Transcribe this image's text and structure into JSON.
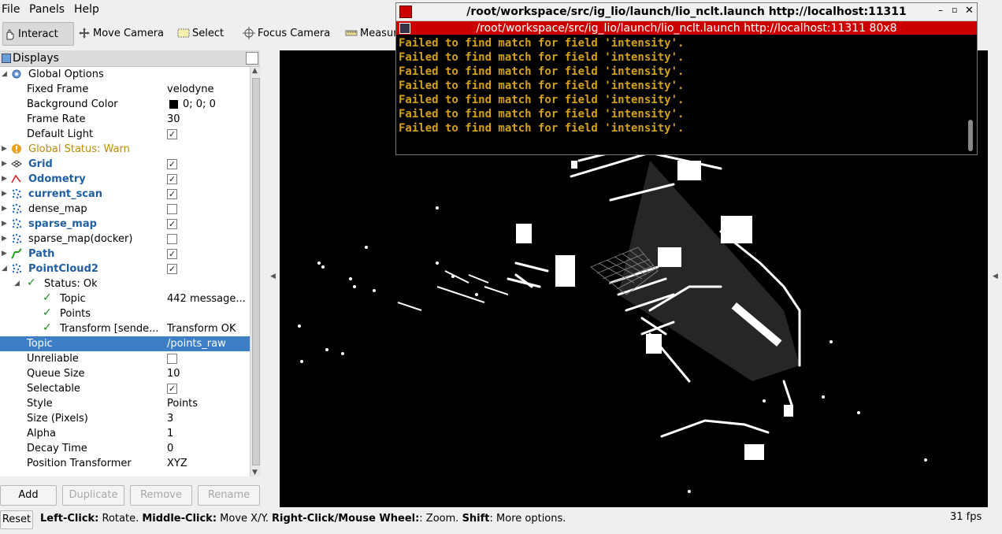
{
  "menu": [
    "File",
    "Panels",
    "Help"
  ],
  "tools": [
    {
      "label": "Interact",
      "icon": "interact-icon",
      "active": true
    },
    {
      "label": "Move Camera",
      "icon": "move-camera-icon"
    },
    {
      "label": "Select",
      "icon": "select-icon"
    },
    {
      "label": "Focus Camera",
      "icon": "focus-camera-icon"
    },
    {
      "label": "Measure",
      "icon": "measure-icon"
    }
  ],
  "displays_title": "Displays",
  "tree": [
    {
      "label": "Global Options",
      "icon": "gear-icon",
      "val": ""
    },
    {
      "label": "Fixed Frame",
      "val": "velodyne"
    },
    {
      "label": "Background Color",
      "val": "0; 0; 0"
    },
    {
      "label": "Frame Rate",
      "val": "30"
    },
    {
      "label": "Default Light",
      "val": "✓"
    },
    {
      "label": "Global Status: Warn"
    },
    {
      "label": "Grid",
      "val": "✓"
    },
    {
      "label": "Odometry",
      "val": "✓"
    },
    {
      "label": "current_scan",
      "val": "✓"
    },
    {
      "label": "dense_map",
      "val": ""
    },
    {
      "label": "sparse_map",
      "val": "✓"
    },
    {
      "label": "sparse_map(docker)",
      "val": ""
    },
    {
      "label": "Path",
      "val": "✓"
    },
    {
      "label": "PointCloud2",
      "val": "✓"
    },
    {
      "label": "Status: Ok"
    },
    {
      "label": "Topic",
      "val": "442 message..."
    },
    {
      "label": "Points"
    },
    {
      "label": "Transform [sende...",
      "val": "Transform OK"
    },
    {
      "label": "Topic",
      "val": "/points_raw"
    },
    {
      "label": "Unreliable",
      "val": ""
    },
    {
      "label": "Queue Size",
      "val": "10"
    },
    {
      "label": "Selectable",
      "val": "✓"
    },
    {
      "label": "Style",
      "val": "Points"
    },
    {
      "label": "Size (Pixels)",
      "val": "3"
    },
    {
      "label": "Alpha",
      "val": "1"
    },
    {
      "label": "Decay Time",
      "val": "0"
    },
    {
      "label": "Position Transformer",
      "val": "XYZ"
    }
  ],
  "buttons": {
    "add": "Add",
    "duplicate": "Duplicate",
    "remove": "Remove",
    "rename": "Rename"
  },
  "status": {
    "reset": "Reset",
    "hint_b1": "Left-Click:",
    "hint_t1": " Rotate. ",
    "hint_b2": "Middle-Click:",
    "hint_t2": " Move X/Y. ",
    "hint_b3": "Right-Click/Mouse Wheel:",
    "hint_t3": ": Zoom. ",
    "hint_b4": "Shift",
    "hint_t4": ": More options.",
    "fps": "31 fps"
  },
  "terminal": {
    "title": "/root/workspace/src/ig_lio/launch/lio_nclt.launch http://localhost:11311",
    "inner_title": "/root/workspace/src/ig_lio/launch/lio_nclt.launch http://localhost:11311 80x8",
    "lines": [
      "Failed to find match for field 'intensity'.",
      "Failed to find match for field 'intensity'.",
      "Failed to find match for field 'intensity'.",
      "Failed to find match for field 'intensity'.",
      "Failed to find match for field 'intensity'.",
      "Failed to find match for field 'intensity'.",
      "Failed to find match for field 'intensity'."
    ]
  }
}
